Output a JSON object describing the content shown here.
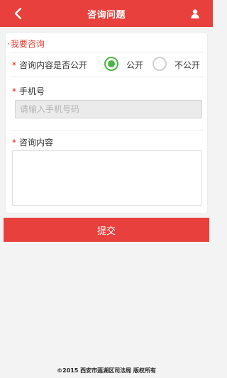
{
  "header": {
    "title": "咨询问题",
    "back_icon": "chevron-left-icon",
    "user_icon": "user-icon",
    "background_color": "#e8403c"
  },
  "form": {
    "section_title": "我要咨询",
    "required_mark": "*",
    "visibility": {
      "label": "咨询内容是否公开",
      "options": [
        {
          "label": "公开",
          "selected": true
        },
        {
          "label": "不公开",
          "selected": false
        }
      ]
    },
    "phone": {
      "label": "手机号",
      "placeholder": "请输入手机号码",
      "value": ""
    },
    "content": {
      "label": "咨询内容",
      "value": ""
    }
  },
  "submit_label": "提交",
  "footer": "©2015 西安市莲湖区司法局 版权所有",
  "colors": {
    "accent": "#e8403c",
    "radio_selected": "#4bb543",
    "required": "#d81e1e"
  }
}
